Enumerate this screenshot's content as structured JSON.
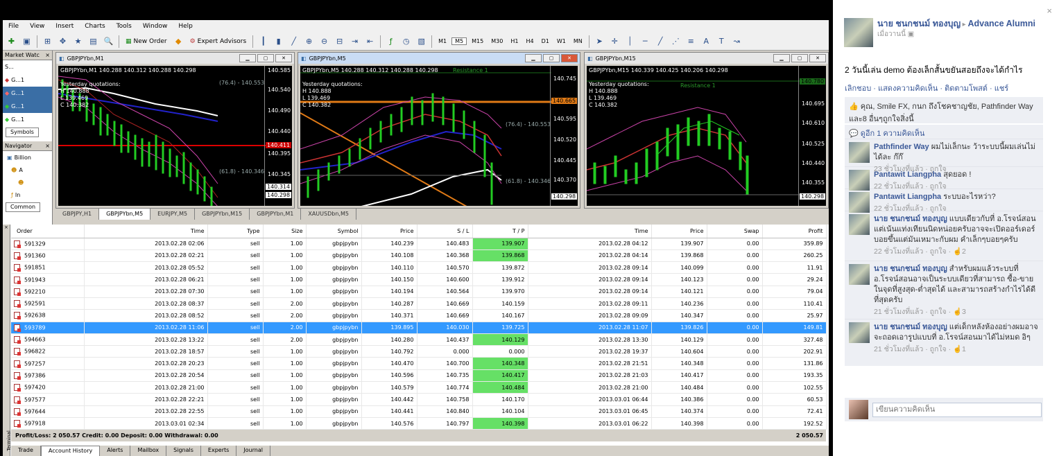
{
  "menu": [
    "File",
    "View",
    "Insert",
    "Charts",
    "Tools",
    "Window",
    "Help"
  ],
  "toolbar": {
    "new_order": "New Order",
    "expert_advisors": "Expert Advisors",
    "timeframes": [
      "M1",
      "M5",
      "M15",
      "M30",
      "H1",
      "H4",
      "D1",
      "W1",
      "MN"
    ]
  },
  "market_watch": {
    "title": "Market Watc",
    "header": "S...",
    "rows": [
      "G...1",
      "G...1",
      "G...1",
      "G...1"
    ],
    "tab": "Symbols"
  },
  "navigator": {
    "title": "Navigator",
    "items": [
      "Billion",
      "A",
      "",
      "In"
    ],
    "tab": "Common"
  },
  "charts": [
    {
      "title": "GBPJPYbn,M1",
      "info": "GBPJPYbn,M1  140.288 140.312 140.288 140.298",
      "yq": [
        "Yesterday quotations:",
        "H 140.888",
        "L 139.469",
        "C 140.382"
      ],
      "fib1": "(76.4) - 140.553",
      "fib2": "(61.8) - 140.346",
      "axis": [
        "140.585",
        "140.540",
        "140.490",
        "140.440",
        "140.395",
        "140.345",
        "140.314",
        "140.298"
      ],
      "hl": "140.411"
    },
    {
      "title": "GBPJPYbn,M5",
      "info": "GBPJPYbn,M5  140.288 140.312 140.288 140.298",
      "yq": [
        "Yesterday quotations:",
        "H 140.888",
        "L 139.469",
        "C 140.382"
      ],
      "resistance": "Resistance 1",
      "fib1": "(76.4) - 140.553",
      "fib2": "(61.8) - 140.346",
      "axis": [
        "140.745",
        "140.670",
        "140.595",
        "140.520",
        "140.445",
        "140.370",
        "140.298"
      ],
      "hl": "140.665"
    },
    {
      "title": "GBPJPYbn,M15",
      "info": "GBPJPYbn,M15  140.339 140.425 140.206 140.298",
      "yq": [
        "Yesterday quotations:",
        "H 140.888",
        "L 139.469",
        "C 140.382"
      ],
      "resistance": "Resistance 1",
      "axis": [
        "140.780",
        "140.695",
        "140.610",
        "140.525",
        "140.440",
        "140.355",
        "140.298"
      ]
    }
  ],
  "chart_tabs": [
    "GBPJPY,H1",
    "GBPJPYbn,M5",
    "EURJPY,M5",
    "GBPJPYbn,M15",
    "GBPJPYbn,M1",
    "XAUUSDbn,M5"
  ],
  "terminal": {
    "side_label": "Terminal",
    "columns": [
      "Order",
      "Time",
      "Type",
      "Size",
      "Symbol",
      "Price",
      "S / L",
      "T / P",
      "Time",
      "Price",
      "Swap",
      "Profit"
    ],
    "rows": [
      [
        "591329",
        "2013.02.28 02:06",
        "sell",
        "1.00",
        "gbpjpybn",
        "140.239",
        "140.483",
        "139.907",
        "2013.02.28 04:12",
        "139.907",
        "0.00",
        "359.89"
      ],
      [
        "591360",
        "2013.02.28 02:21",
        "sell",
        "1.00",
        "gbpjpybn",
        "140.108",
        "140.368",
        "139.868",
        "2013.02.28 04:14",
        "139.868",
        "0.00",
        "260.25"
      ],
      [
        "591851",
        "2013.02.28 05:52",
        "sell",
        "1.00",
        "gbpjpybn",
        "140.110",
        "140.570",
        "139.872",
        "2013.02.28 09:14",
        "140.099",
        "0.00",
        "11.91"
      ],
      [
        "591943",
        "2013.02.28 06:21",
        "sell",
        "1.00",
        "gbpjpybn",
        "140.150",
        "140.600",
        "139.912",
        "2013.02.28 09:14",
        "140.123",
        "0.00",
        "29.24"
      ],
      [
        "592210",
        "2013.02.28 07:30",
        "sell",
        "1.00",
        "gbpjpybn",
        "140.194",
        "140.564",
        "139.970",
        "2013.02.28 09:14",
        "140.121",
        "0.00",
        "79.04"
      ],
      [
        "592591",
        "2013.02.28 08:37",
        "sell",
        "2.00",
        "gbpjpybn",
        "140.287",
        "140.669",
        "140.159",
        "2013.02.28 09:11",
        "140.236",
        "0.00",
        "110.41"
      ],
      [
        "592638",
        "2013.02.28 08:52",
        "sell",
        "2.00",
        "gbpjpybn",
        "140.371",
        "140.669",
        "140.167",
        "2013.02.28 09:09",
        "140.347",
        "0.00",
        "25.97"
      ],
      [
        "593789",
        "2013.02.28 11:06",
        "sell",
        "2.00",
        "gbpjpybn",
        "139.895",
        "140.030",
        "139.725",
        "2013.02.28 11:07",
        "139.826",
        "0.00",
        "149.81"
      ],
      [
        "594663",
        "2013.02.28 13:22",
        "sell",
        "2.00",
        "gbpjpybn",
        "140.280",
        "140.437",
        "140.129",
        "2013.02.28 13:30",
        "140.129",
        "0.00",
        "327.48"
      ],
      [
        "596822",
        "2013.02.28 18:57",
        "sell",
        "1.00",
        "gbpjpybn",
        "140.792",
        "0.000",
        "0.000",
        "2013.02.28 19:37",
        "140.604",
        "0.00",
        "202.91"
      ],
      [
        "597257",
        "2013.02.28 20:23",
        "sell",
        "1.00",
        "gbpjpybn",
        "140.470",
        "140.700",
        "140.348",
        "2013.02.28 21:51",
        "140.348",
        "0.00",
        "131.86"
      ],
      [
        "597386",
        "2013.02.28 20:54",
        "sell",
        "1.00",
        "gbpjpybn",
        "140.596",
        "140.735",
        "140.417",
        "2013.02.28 21:03",
        "140.417",
        "0.00",
        "193.35"
      ],
      [
        "597420",
        "2013.02.28 21:00",
        "sell",
        "1.00",
        "gbpjpybn",
        "140.579",
        "140.774",
        "140.484",
        "2013.02.28 21:00",
        "140.484",
        "0.00",
        "102.55"
      ],
      [
        "597577",
        "2013.02.28 22:21",
        "sell",
        "1.00",
        "gbpjpybn",
        "140.442",
        "140.758",
        "140.170",
        "2013.03.01 06:44",
        "140.386",
        "0.00",
        "60.53"
      ],
      [
        "597644",
        "2013.02.28 22:55",
        "sell",
        "1.00",
        "gbpjpybn",
        "140.441",
        "140.840",
        "140.104",
        "2013.03.01 06:45",
        "140.374",
        "0.00",
        "72.41"
      ],
      [
        "597918",
        "2013.03.01 02:34",
        "sell",
        "1.00",
        "gbpjpybn",
        "140.576",
        "140.797",
        "140.398",
        "2013.03.01 06:22",
        "140.398",
        "0.00",
        "192.52"
      ]
    ],
    "tp_hit_rows": [
      0,
      1,
      8,
      10,
      11,
      12,
      15
    ],
    "selected_row": 7,
    "summary": "Profit/Loss: 2 050.57  Credit: 0.00  Deposit: 0.00  Withdrawal: 0.00",
    "total": "2 050.57",
    "tabs": [
      "Trade",
      "Account History",
      "Alerts",
      "Mailbox",
      "Signals",
      "Experts",
      "Journal"
    ]
  },
  "facebook": {
    "author": "นาย ชนกชนม์ ทองบุญ",
    "group": "Advance Alumni",
    "time": "เมื่อวานนี้",
    "post": "2 วันนี้เล่น demo ต้องเล็กสั้นขยันสอยถึงจะได้กำไร",
    "actions": "เลิกชอบ · แสดงความคิดเห็น · ติดตามโพสต์ · แชร์",
    "likes": "คุณ, Smile FX, กนก ถึงโชคชาญชัย, Pathfinder Way และ8 อื่นๆถูกใจสิ่งนี้",
    "comment_count": "ดูอีก 1 ความคิดเห็น",
    "comments": [
      {
        "name": "Pathfinder Way",
        "text": "ผมไม่เล็กนะ ว้าระบบนี้ผมเล่นไม่ได้ละ ก๊ก๊",
        "time": "23 ชั่วโมงที่แล้ว · ถูกใจ"
      },
      {
        "name": "Pantawit Liangpha",
        "text": "สุดยอด !",
        "time": "22 ชั่วโมงที่แล้ว · ถูกใจ"
      },
      {
        "name": "Pantawit Liangpha",
        "text": "ระบบอะไรหว่า?",
        "time": "22 ชั่วโมงที่แล้ว · ถูกใจ"
      },
      {
        "name": "นาย ชนกชนม์ ทองบุญ",
        "text": "แบบเดียวกับที่ อ.โรจน์สอน แต่เน้นแท่งเทียนนิดหน่อยครับอาจจะเปิดออร์เดอร์บอยขึ้นแต่มันเหมาะกับผม คำเล็กๆบอยๆครับ",
        "time": "22 ชั่วโมงที่แล้ว · ถูกใจ · ☝2"
      },
      {
        "name": "นาย ชนกชนม์ ทองบุญ",
        "text": "สำหรับผมแล้วระบบที่ อ.โรจน์สอนอาจเป็นระบบเดียวที่สามารถ ซื้อ-ขายในจุดที่สูงสุด-ต่ำสุดได้ และสามารถสร้างกำไรได้ดีที่สุดครับ",
        "time": "21 ชั่วโมงที่แล้ว · ถูกใจ · ☝3"
      },
      {
        "name": "นาย ชนกชนม์ ทองบุญ",
        "text": "แต่เด็กหลังห้องอย่างผมอาจจะถอดเอารูปแบบที่ อ.โรจน์สอนมาได้ไม่หมด อิๆ",
        "time": "21 ชั่วโมงที่แล้ว · ถูกใจ · ☝1"
      }
    ],
    "comment_placeholder": "เขียนความคิดเห็น"
  }
}
